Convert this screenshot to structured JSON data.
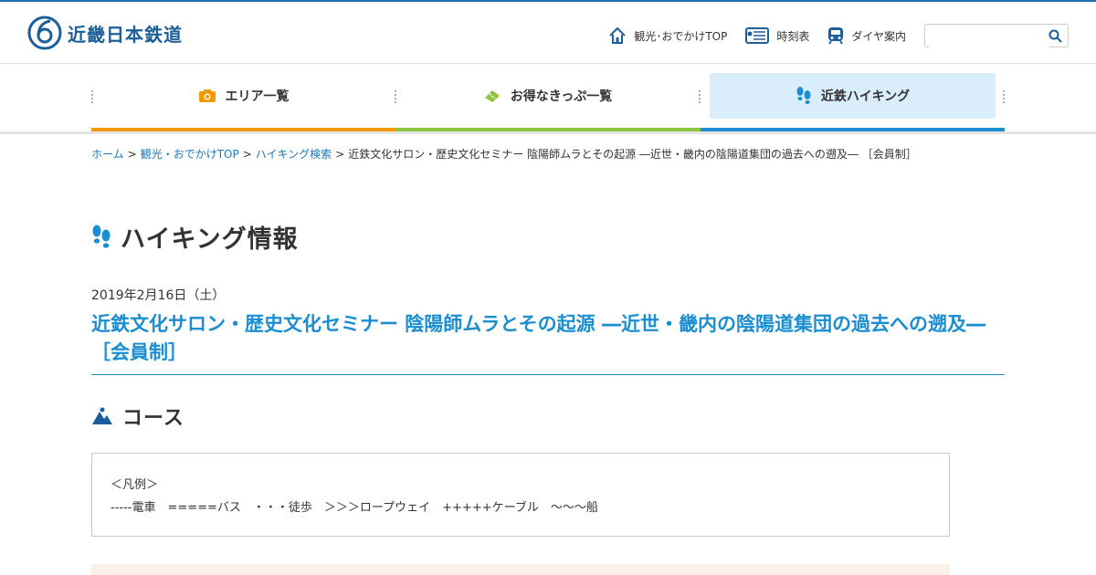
{
  "brand": {
    "name": "近畿日本鉄道",
    "color": "#1b5e99"
  },
  "utility_nav": [
    {
      "label": "観光･おでかけTOP",
      "icon": "home-icon"
    },
    {
      "label": "時刻表",
      "icon": "timetable-icon"
    },
    {
      "label": "ダイヤ案内",
      "icon": "train-icon"
    }
  ],
  "search": {
    "placeholder": "",
    "value": ""
  },
  "main_nav": [
    {
      "label": "エリア一覧",
      "icon": "camera-icon",
      "color": "#f39800"
    },
    {
      "label": "お得なきっぷ一覧",
      "icon": "ticket-icon",
      "color": "#8cc63f"
    },
    {
      "label": "近鉄ハイキング",
      "icon": "footprints-icon",
      "color": "#1b8ed2",
      "active": true
    }
  ],
  "breadcrumb": {
    "items": [
      "ホーム",
      "観光・おでかけTOP",
      "ハイキング検索"
    ],
    "separator": ">",
    "current": "近鉄文化サロン・歴史文化セミナー 陰陽師ムラとその起源 ―近世・畿内の陰陽道集団の過去への遡及― ［会員制］"
  },
  "page": {
    "heading": "ハイキング情報",
    "date": "2019年2月16日（土）",
    "event_title": "近鉄文化サロン・歴史文化セミナー 陰陽師ムラとその起源 ―近世・畿内の陰陽道集団の過去への遡及― ［会員制］",
    "course_heading": "コース"
  },
  "legend": {
    "title": "＜凡例＞",
    "line": "-----電車　=====バス　・・・徒歩　＞＞＞ロープウェイ　+++++ケーブル　〜〜〜船"
  },
  "colors": {
    "accent": "#1b8ed2",
    "orange": "#f39800",
    "green": "#8cc63f",
    "active_tab_bg": "#d9eefa"
  }
}
